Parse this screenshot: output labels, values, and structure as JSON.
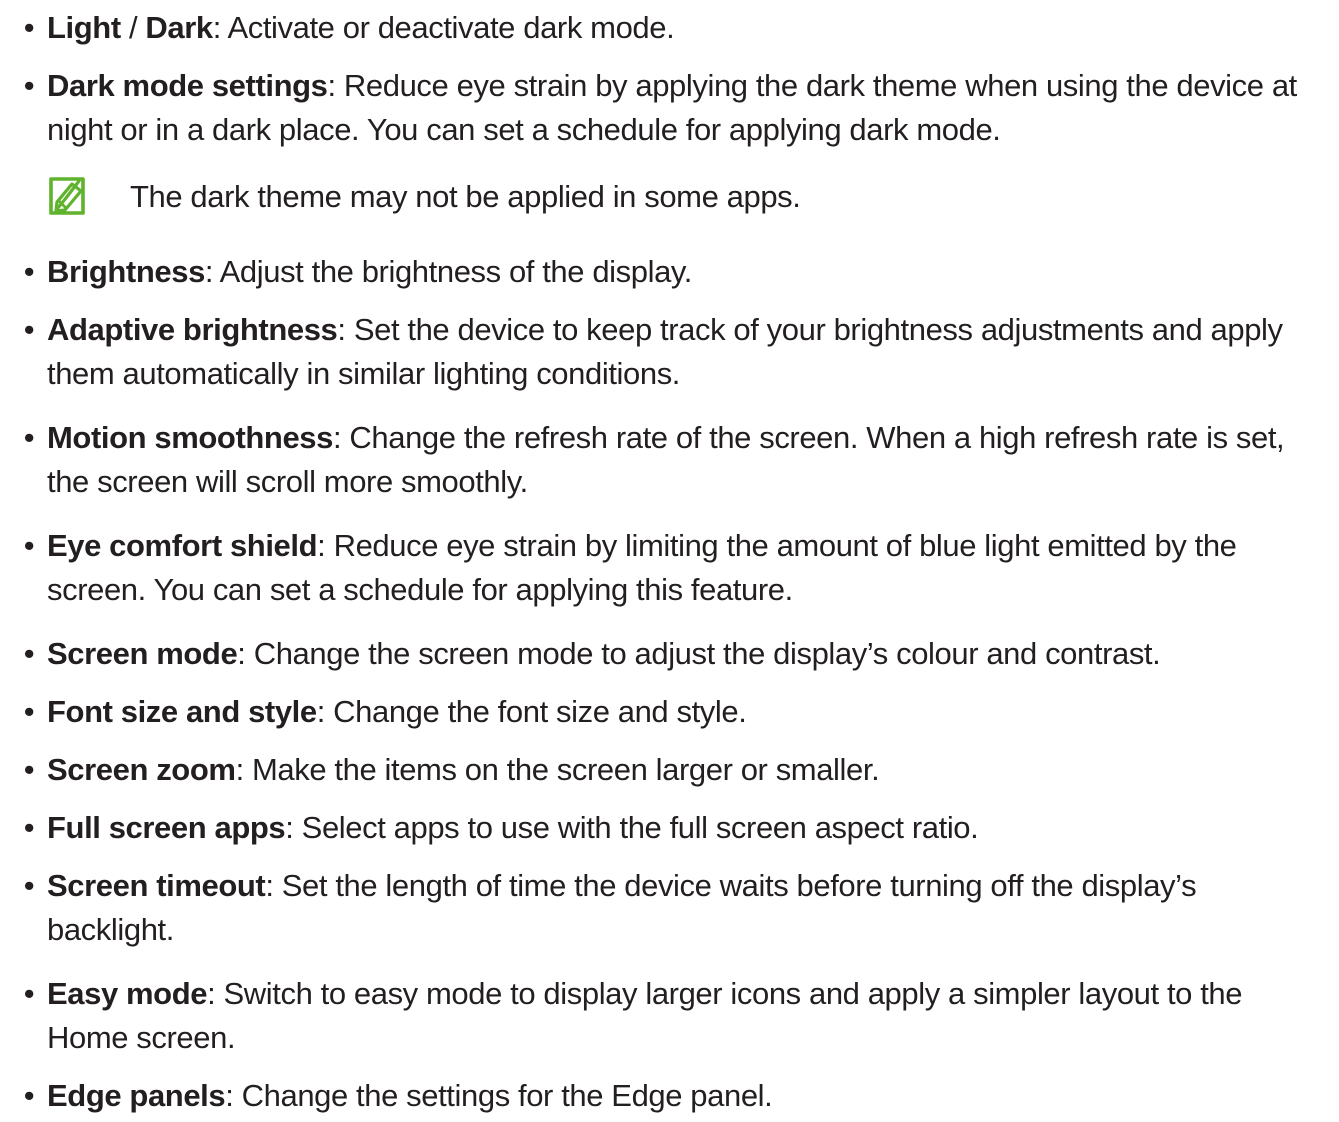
{
  "items": [
    {
      "term_parts": [
        "Light",
        " / ",
        "Dark"
      ],
      "desc": ": Activate or deactivate dark mode."
    },
    {
      "term": "Dark mode settings",
      "desc": ": Reduce eye strain by applying the dark theme when using the device at night or in a dark place. You can set a schedule for applying dark mode."
    },
    {
      "term": "Brightness",
      "desc": ": Adjust the brightness of the display."
    },
    {
      "term": "Adaptive brightness",
      "desc": ": Set the device to keep track of your brightness adjustments and apply them automatically in similar lighting conditions."
    },
    {
      "term": "Motion smoothness",
      "desc": ": Change the refresh rate of the screen. When a high refresh rate is set, the screen will scroll more smoothly."
    },
    {
      "term": "Eye comfort shield",
      "desc": ": Reduce eye strain by limiting the amount of blue light emitted by the screen. You can set a schedule for applying this feature."
    },
    {
      "term": "Screen mode",
      "desc": ": Change the screen mode to adjust the display’s colour and contrast."
    },
    {
      "term": "Font size and style",
      "desc": ": Change the font size and style."
    },
    {
      "term": "Screen zoom",
      "desc": ": Make the items on the screen larger or smaller."
    },
    {
      "term": "Full screen apps",
      "desc": ": Select apps to use with the full screen aspect ratio."
    },
    {
      "term": "Screen timeout",
      "desc": ": Set the length of time the device waits before turning off the display’s backlight."
    },
    {
      "term": "Easy mode",
      "desc": ": Switch to easy mode to display larger icons and apply a simpler layout to the Home screen."
    },
    {
      "term": "Edge panels",
      "desc": ": Change the settings for the Edge panel."
    }
  ],
  "note": {
    "icon": "note-pencil-icon",
    "text": "The dark theme may not be applied in some apps."
  },
  "colors": {
    "text": "#231f20",
    "note_icon": "#5fb32d"
  },
  "bullet": "•"
}
